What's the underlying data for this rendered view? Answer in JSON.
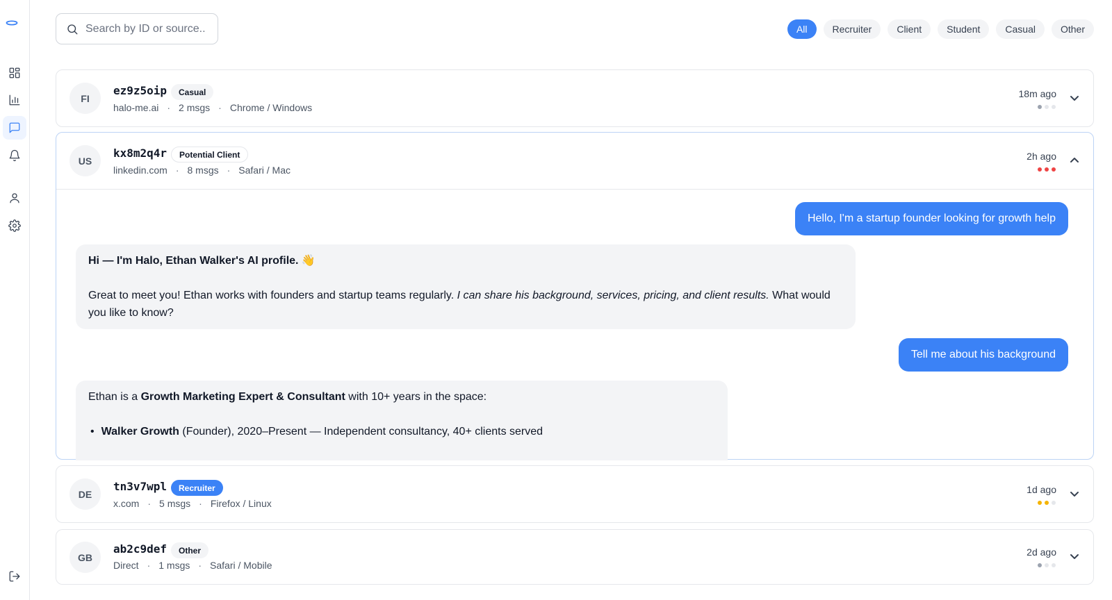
{
  "search": {
    "placeholder": "Search by ID or source.."
  },
  "filters": [
    "All",
    "Recruiter",
    "Client",
    "Student",
    "Casual",
    "Other"
  ],
  "colors": {
    "accent": "#3b82f6",
    "dot_red": "#ef4444",
    "dot_yellow": "#f5b400",
    "dot_gray": "#9ca3af",
    "dot_empty": "#e5e7eb"
  },
  "sidebar": {
    "icons": [
      "dashboard-icon",
      "chart-icon",
      "message-icon",
      "bell-icon",
      "user-icon",
      "gear-icon",
      "logout-icon"
    ]
  },
  "conversations": [
    {
      "initials": "FI",
      "id": "ez9z5oip",
      "tag": "Casual",
      "source": "halo-me.ai",
      "msgs": "2 msgs",
      "browser": "Chrome / Windows",
      "time": "18m ago",
      "level": 1,
      "level_color": "#9ca3af"
    },
    {
      "initials": "US",
      "id": "kx8m2q4r",
      "tag": "Potential Client",
      "source": "linkedin.com",
      "msgs": "8 msgs",
      "browser": "Safari / Mac",
      "time": "2h ago",
      "level": 3,
      "level_color": "#ef4444",
      "messages": {
        "user1": "Hello, I'm a startup founder looking for growth help",
        "bot1_title": "Hi — I'm Halo, Ethan Walker's AI profile. 👋",
        "bot1_a": "Great to meet you! Ethan works with founders and startup teams regularly. ",
        "bot1_em": "I can share his background, services, pricing, and client results.",
        "bot1_b": " What would you like to know?",
        "user2": "Tell me about his background",
        "bot2_a": "Ethan is a ",
        "bot2_strong": "Growth Marketing Expert & Consultant",
        "bot2_b": " with 10+ years in the space:",
        "bot2_li_strong": "Walker Growth",
        "bot2_li_rest": " (Founder), 2020–Present — Independent consultancy, 40+ clients served"
      }
    },
    {
      "initials": "DE",
      "id": "tn3v7wpl",
      "tag": "Recruiter",
      "source": "x.com",
      "msgs": "5 msgs",
      "browser": "Firefox / Linux",
      "time": "1d ago",
      "level": 2,
      "level_color": "#f5b400"
    },
    {
      "initials": "GB",
      "id": "ab2c9def",
      "tag": "Other",
      "source": "Direct",
      "msgs": "1 msgs",
      "browser": "Safari / Mobile",
      "time": "2d ago",
      "level": 1,
      "level_color": "#9ca3af"
    }
  ]
}
